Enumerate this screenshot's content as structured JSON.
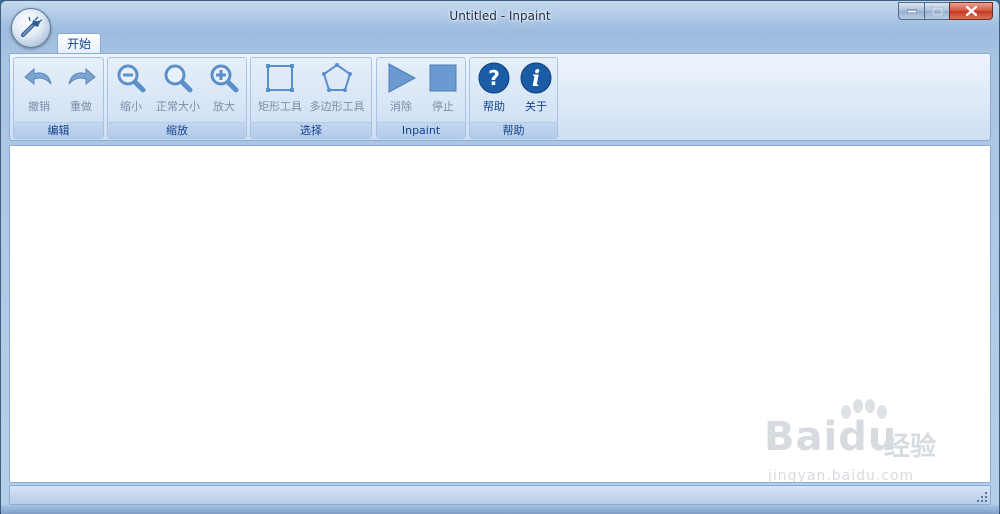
{
  "window": {
    "title": "Untitled - Inpaint"
  },
  "tabs": [
    {
      "label": "开始"
    }
  ],
  "ribbon": {
    "groups": [
      {
        "label": "编辑",
        "buttons": [
          {
            "label": "撤销",
            "icon": "undo-icon"
          },
          {
            "label": "重做",
            "icon": "redo-icon"
          }
        ]
      },
      {
        "label": "缩放",
        "buttons": [
          {
            "label": "缩小",
            "icon": "zoom-out-icon"
          },
          {
            "label": "正常大小",
            "icon": "zoom-normal-icon"
          },
          {
            "label": "放大",
            "icon": "zoom-in-icon"
          }
        ]
      },
      {
        "label": "选择",
        "buttons": [
          {
            "label": "矩形工具",
            "icon": "rectangle-tool-icon"
          },
          {
            "label": "多边形工具",
            "icon": "polygon-tool-icon"
          }
        ]
      },
      {
        "label": "Inpaint",
        "buttons": [
          {
            "label": "消除",
            "icon": "play-icon"
          },
          {
            "label": "停止",
            "icon": "stop-icon"
          }
        ]
      },
      {
        "label": "帮助",
        "buttons": [
          {
            "label": "帮助",
            "icon": "help-icon"
          },
          {
            "label": "关于",
            "icon": "info-icon"
          }
        ]
      }
    ]
  },
  "watermark": {
    "logo": "Bai",
    "logo2": "du",
    "text": "经验",
    "url": "jingyan.baidu.com"
  },
  "colors": {
    "accent": "#15428b",
    "icon_blue": "#5b8fc8",
    "help_blue": "#1a5da6",
    "disabled_text": "#7d8ea6"
  }
}
